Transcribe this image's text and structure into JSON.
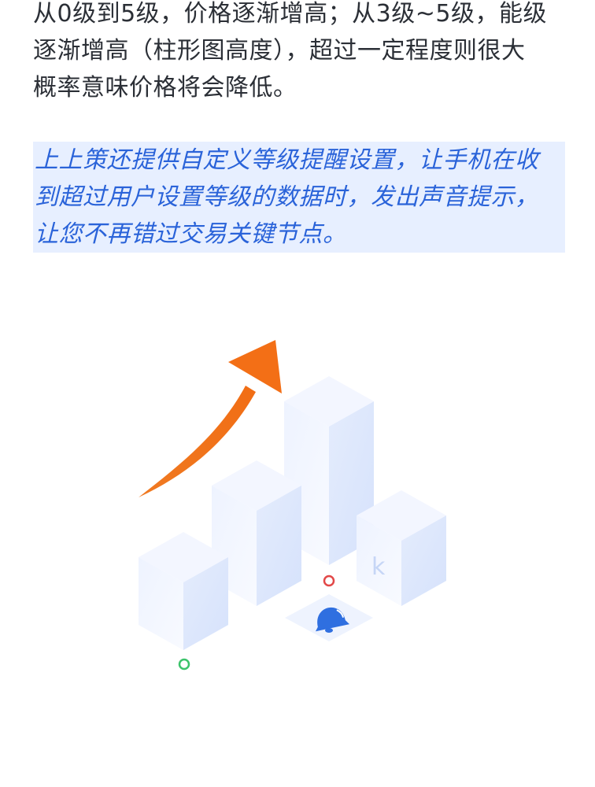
{
  "paragraph": {
    "lines": [
      "从0级到5级，价格逐渐增高；从3级~5级，能级",
      "逐渐增高（柱形图高度），超过一定程度则很大",
      "概率意味价格将会降低。"
    ]
  },
  "highlight": {
    "lines": [
      "上上策还提供自定义等级提醒设置，让手机在收",
      "到超过用户设置等级的数据时，发出声音提示，",
      "让您不再错过交易关键节点。"
    ]
  },
  "illustration": {
    "box_letter": "k",
    "colors": {
      "arrow": "#f3751f",
      "box_top": "#edf2ff",
      "box_side_light": "#f4f7ff",
      "box_side_dark": "#dce6fb",
      "bell": "#2f6fe0",
      "dot_red": "#e04a4a",
      "dot_green": "#3cc36b"
    },
    "icons": [
      "up-arrow-icon",
      "bell-icon"
    ]
  }
}
